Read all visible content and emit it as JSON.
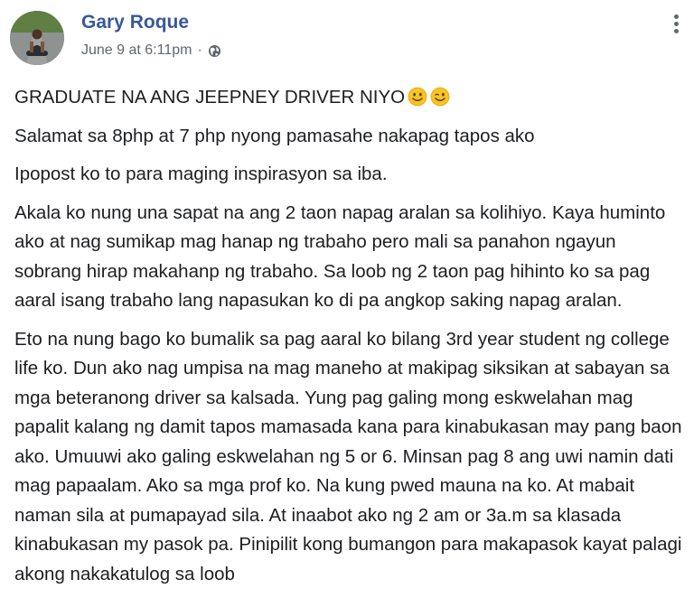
{
  "post": {
    "author_name": "Gary Roque",
    "timestamp": "June 9 at 6:11pm",
    "separator": "·",
    "privacy_icon": "globe-icon",
    "more_icon": "more-options-icon",
    "paragraphs": [
      {
        "text": "GRADUATE NA ANG JEEPNEY DRIVER NIYO",
        "emojis": [
          "smiley-emoji",
          "wink-emoji"
        ]
      },
      {
        "text": "Salamat sa 8php at 7 php nyong pamasahe nakapag tapos ako"
      },
      {
        "text": "Ipopost ko to para maging inspirasyon sa iba."
      },
      {
        "text": "Akala ko nung una sapat na ang 2 taon napag aralan sa kolihiyo. Kaya huminto ako at nag sumikap mag hanap ng trabaho pero mali sa panahon ngayun sobrang hirap makahanp ng trabaho. Sa loob ng 2 taon pag hihinto ko sa pag aaral isang trabaho lang napasukan ko di pa angkop saking napag aralan."
      },
      {
        "text": "Eto na nung bago ko bumalik sa pag aaral ko bilang 3rd year student ng college life ko. Dun ako nag umpisa na mag maneho at makipag siksikan at sabayan sa mga beteranong driver sa kalsada. Yung pag galing mong eskwelahan mag papalit kalang ng damit tapos mamasada kana para kinabukasan may pang baon ako. Umuuwi ako galing eskwelahan ng 5 or 6. Minsan pag 8 ang uwi namin dati mag papaalam. Ako sa mga prof ko. Na kung pwed mauna na ko. At mabait naman sila at pumapayad sila. At inaabot ako ng 2 am or 3a.m sa klasada kinabukasan my pasok pa. Pinipilit kong bumangon para makapasok kayat palagi akong nakakatulog sa loob"
      }
    ]
  },
  "colors": {
    "author": "#385898",
    "meta": "#616770",
    "text": "#1c1e21",
    "emoji_face": "#f7c325"
  }
}
